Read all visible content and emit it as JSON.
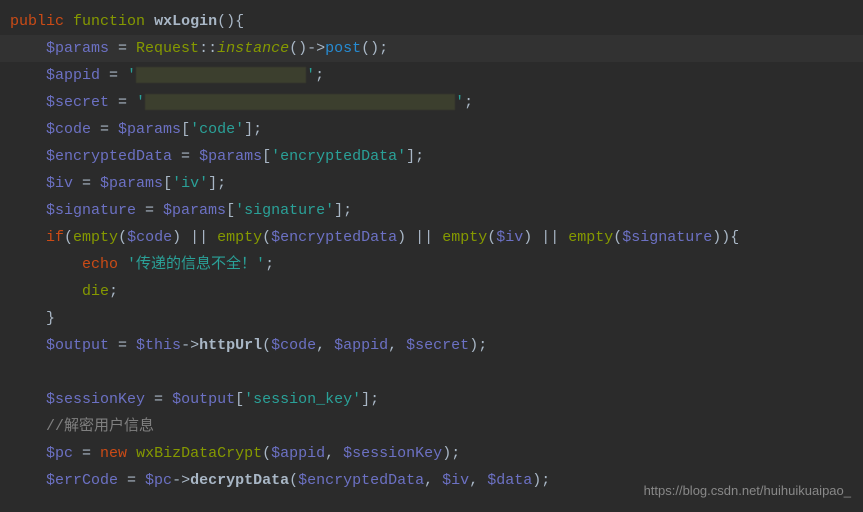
{
  "lines": {
    "l1_public": "public",
    "l1_function": "function",
    "l1_name": "wxLogin",
    "l2_var": "$params",
    "l2_req": "Request",
    "l2_inst": "instance",
    "l2_post": "post",
    "l3_var": "$appid",
    "l4_var": "$secret",
    "l5_var": "$code",
    "l5_src": "$params",
    "l5_key": "'code'",
    "l6_var": "$encryptedData",
    "l6_src": "$params",
    "l6_key": "'encryptedData'",
    "l7_var": "$iv",
    "l7_src": "$params",
    "l7_key": "'iv'",
    "l8_var": "$signature",
    "l8_src": "$params",
    "l8_key": "'signature'",
    "l9_if": "if",
    "l9_empty": "empty",
    "l9_v1": "$code",
    "l9_v2": "$encryptedData",
    "l9_v3": "$iv",
    "l9_v4": "$signature",
    "l10_echo": "echo",
    "l10_msg": "'传递的信息不全！'",
    "l11_die": "die",
    "l13_var": "$output",
    "l13_this": "$this",
    "l13_fn": "httpUrl",
    "l13_a1": "$code",
    "l13_a2": "$appid",
    "l13_a3": "$secret",
    "l15_var": "$sessionKey",
    "l15_src": "$output",
    "l15_key": "'session_key'",
    "l16_comment": "//解密用户信息",
    "l17_var": "$pc",
    "l17_new": "new",
    "l17_class": "wxBizDataCrypt",
    "l17_a1": "$appid",
    "l17_a2": "$sessionKey",
    "l18_var": "$errCode",
    "l18_src": "$pc",
    "l18_fn": "decryptData",
    "l18_a1": "$encryptedData",
    "l18_a2": "$iv",
    "l18_a3": "$data"
  },
  "watermark": "https://blog.csdn.net/huihuikuaipao_"
}
